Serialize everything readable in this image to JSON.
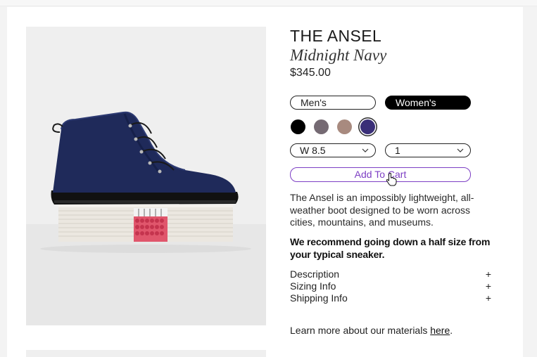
{
  "product": {
    "name": "THE ANSEL",
    "color_name": "Midnight Navy",
    "price": "$345.00",
    "image_alt": "Navy suede hiking boot on stacked magazines"
  },
  "gender_toggle": {
    "mens_label": "Men's",
    "womens_label": "Women's",
    "selected": "Women's"
  },
  "swatches": [
    {
      "name": "black",
      "color": "#000000"
    },
    {
      "name": "grey",
      "color": "#756a73"
    },
    {
      "name": "taupe",
      "color": "#a88a7f"
    },
    {
      "name": "midnight-navy",
      "color": "#3a2f78",
      "selected": true
    }
  ],
  "size_select": {
    "value": "W 8.5"
  },
  "qty_select": {
    "value": "1"
  },
  "cart": {
    "label": "Add To Cart",
    "accent": "#7d3fc4"
  },
  "description": "The Ansel is an impossibly lightweight, all-weather boot designed to be worn across cities, mountains, and museums.",
  "recommendation": "We recommend going down a half size from your typical sneaker.",
  "accordion": [
    {
      "label": "Description",
      "icon": "+"
    },
    {
      "label": "Sizing Info",
      "icon": "+"
    },
    {
      "label": "Shipping Info",
      "icon": "+"
    }
  ],
  "materials": {
    "prefix": "Learn more about our materials ",
    "link": "here",
    "suffix": "."
  }
}
